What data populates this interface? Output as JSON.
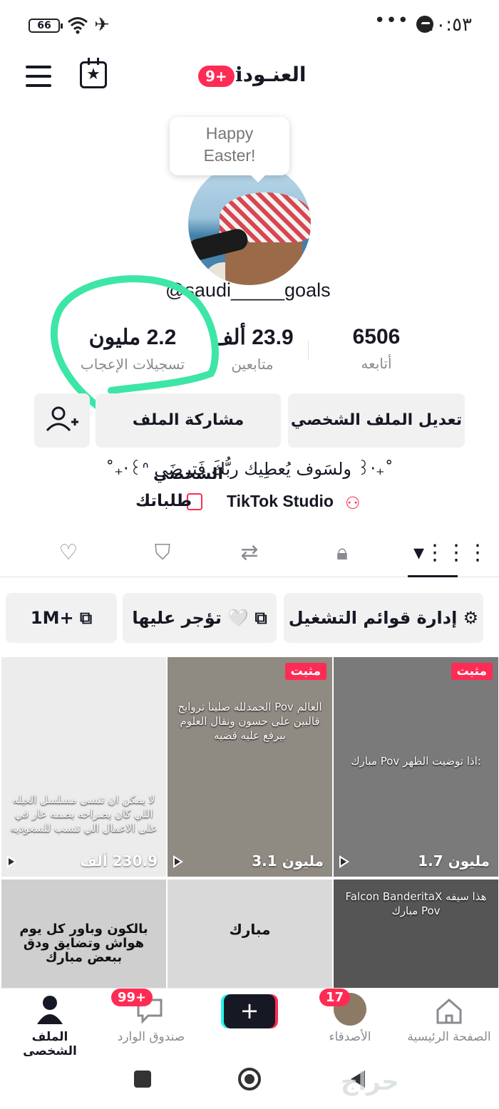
{
  "status_bar": {
    "time": "١٠:٥٣",
    "battery": "66",
    "dots": "•••"
  },
  "header": {
    "username": "العنـودℹ",
    "notification_badge": "9+"
  },
  "profile": {
    "bubble_text_1": "Happy",
    "bubble_text_2": "Easter!",
    "handle": "@saudi_____goals",
    "bio": "˚₊‧꒰ᐢ ولسَوف يُعطِيك ربُّكَ فَترضَى ꒱‧₊˚",
    "studio_label": "TikTok Studio",
    "orders_label": "طلباتك"
  },
  "stats": [
    {
      "value": "6506",
      "label": "أتابعه"
    },
    {
      "value": "23.9 ألف",
      "label": "متابعين"
    },
    {
      "value": "2.2 مليون",
      "label": "تسجيلات الإعجاب"
    }
  ],
  "buttons": {
    "edit_profile": "تعديل الملف الشخصي",
    "share_profile": "مشاركة الملف الشخصي"
  },
  "chips": {
    "manage_playlists": "إدارة قوائم التشغيل",
    "tojar": "تؤجر عليها 🤍",
    "million": "1M+"
  },
  "grid": [
    {
      "views": "1.7 مليون",
      "pinned": "مثبت",
      "caption": "مبارك Pov اذا توضيت الظهر:",
      "bg": "#7a7a7a"
    },
    {
      "views": "3.1 مليون",
      "pinned": "مثبت",
      "caption": "الحمدلله صلينا تروايح Pov العالم قالبين على حسون ونقال العلوم بيرفع عليه قضيه",
      "bg": "#8f8a82"
    },
    {
      "views": "230.9 ألف",
      "pinned": "",
      "caption": "لا يمكن ان تنسى مسلسل العيله اللي كان يصراحه بصمه عار في على الاعمال الي تنسب للسعوديه",
      "bg": "#ececec"
    },
    {
      "views": "",
      "pinned": "",
      "caption": "Falcon BanderitaX هذا سيفه مبارك Pov",
      "bg": "#555"
    },
    {
      "views": "",
      "pinned": "",
      "caption": "مبارك",
      "bg": "#d9d9d9"
    },
    {
      "views": "",
      "pinned": "",
      "caption": "بالكون وباور كل يوم هواش وتضايق ودق ببعض مبارك",
      "bg": "#cfcfcf"
    }
  ],
  "nav": {
    "home": "الصفحة الرئيسية",
    "friends": "الأصدقاء",
    "friends_badge": "17",
    "inbox": "صندوق الوارد",
    "inbox_badge": "99+",
    "profile": "الملف الشخصي",
    "add": "+"
  },
  "watermark": "حراج",
  "colors": {
    "accent": "#fe2c55",
    "marker": "#3de6a6",
    "cyan": "#25f4ee"
  }
}
